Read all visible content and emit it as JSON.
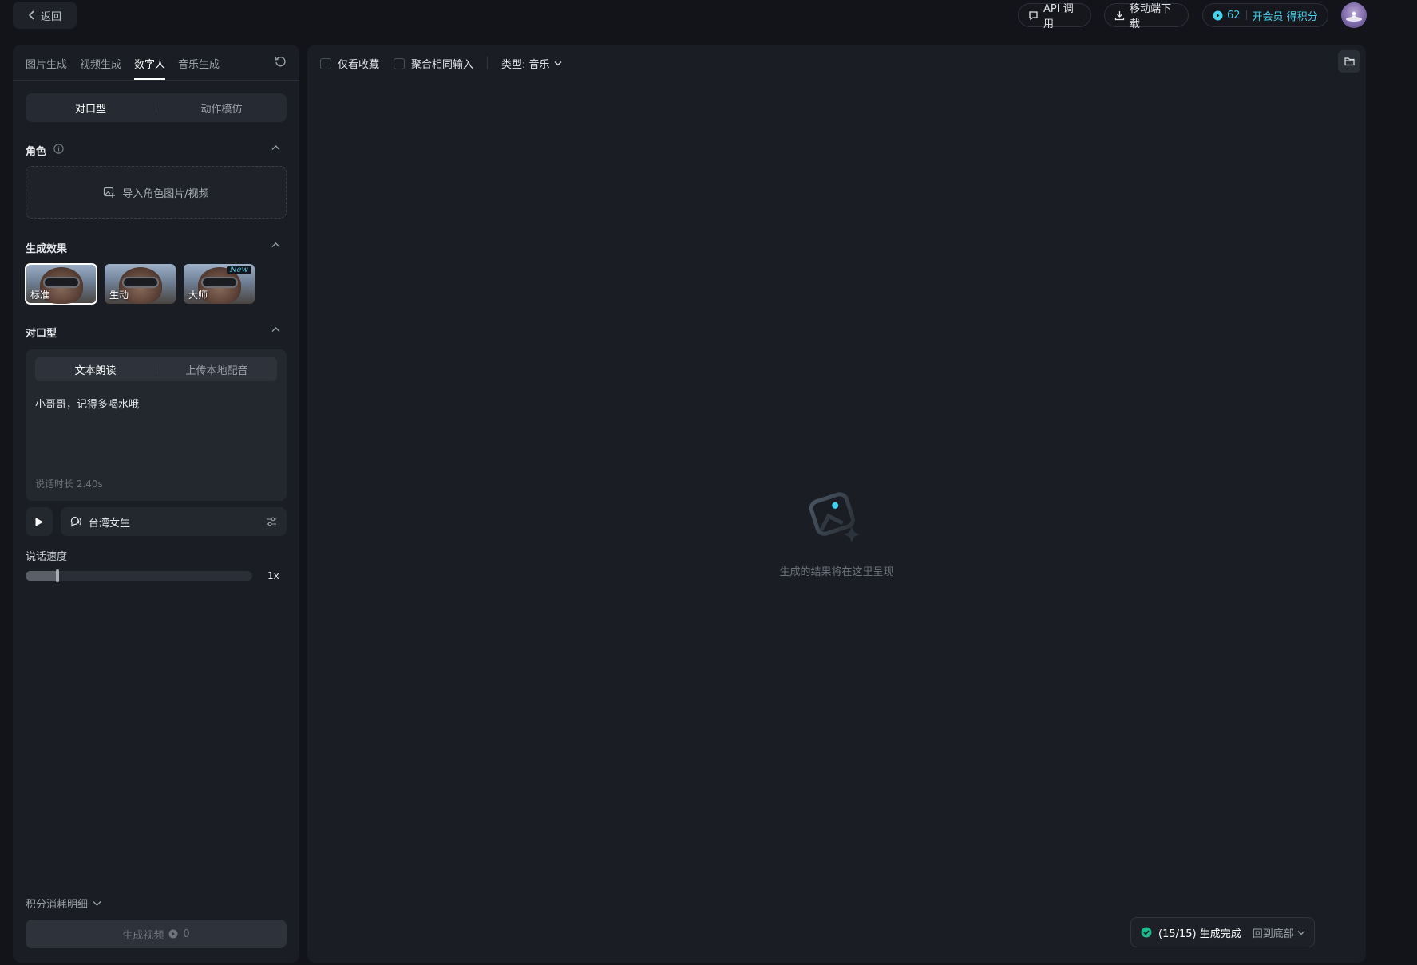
{
  "topbar": {
    "back_label": "返回",
    "api_label": "API 调用",
    "download_label": "移动端下载",
    "credits": "62",
    "vip_label": "开会员 得积分"
  },
  "left": {
    "tabs": [
      {
        "label": "图片生成"
      },
      {
        "label": "视频生成"
      },
      {
        "label": "数字人",
        "active": true
      },
      {
        "label": "音乐生成"
      }
    ],
    "mode": {
      "options": [
        "对口型",
        "动作模仿"
      ],
      "selected": "对口型"
    },
    "role": {
      "title": "角色",
      "upload_label": "导入角色图片/视频"
    },
    "effect": {
      "title": "生成效果",
      "options": [
        {
          "label": "标准",
          "selected": true
        },
        {
          "label": "生动",
          "selected": false
        },
        {
          "label": "大师",
          "selected": false,
          "badge": "New"
        }
      ]
    },
    "lipsync": {
      "title": "对口型",
      "input_modes": [
        "文本朗读",
        "上传本地配音"
      ],
      "selected_mode": "文本朗读",
      "text": "小哥哥，记得多喝水哦",
      "duration": "说话时长 2.40s",
      "voice": "台湾女生"
    },
    "speed": {
      "label": "说话速度",
      "value_label": "1x",
      "fraction": 0.14
    },
    "cost_label": "积分消耗明细",
    "generate": {
      "label": "生成视频",
      "cost": "0"
    }
  },
  "right": {
    "filters": [
      {
        "label": "仅看收藏",
        "checked": false
      },
      {
        "label": "聚合相同输入",
        "checked": false
      }
    ],
    "type_filter": "类型: 音乐",
    "empty_text": "生成的结果将在这里呈现",
    "toast": {
      "status": "(15/15) 生成完成",
      "link": "回到底部"
    }
  },
  "colors": {
    "accent": "#43d1ec",
    "success": "#1fb88a",
    "panel": "#1a1d23",
    "background": "#121419"
  }
}
